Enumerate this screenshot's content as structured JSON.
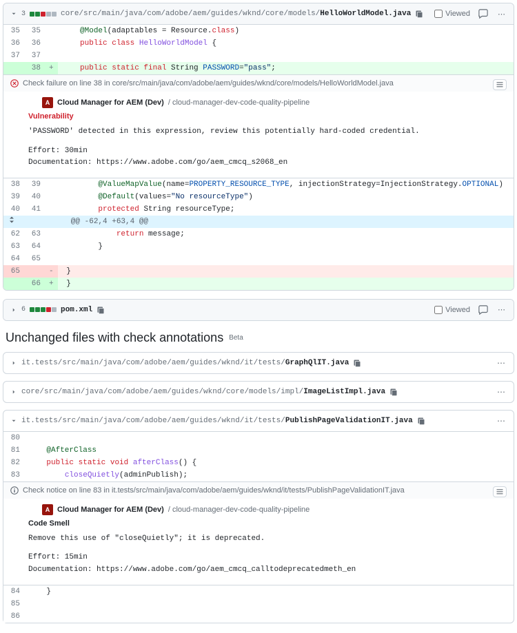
{
  "viewed_label": "Viewed",
  "file1": {
    "changes": "3",
    "path_prefix": "core/src/main/java/com/adobe/aem/guides/wknd/core/models/",
    "path_file": "HelloWorldModel.java",
    "lines": {
      "l35a": "35",
      "l35b": "35",
      "c35": "    @Model(adaptables = Resource.class)",
      "l36a": "36",
      "l36b": "36",
      "c36": "    public class HelloWorldModel {",
      "l37a": "37",
      "l37b": "37",
      "c37": "",
      "l38b": "38",
      "c38": "    public static final String PASSWORD=\"pass\";",
      "l39a": "38",
      "l39b": "39",
      "c39": "        @ValueMapValue(name=PROPERTY_RESOURCE_TYPE, injectionStrategy=InjectionStrategy.OPTIONAL)",
      "l40a": "39",
      "l40b": "40",
      "c40": "        @Default(values=\"No resourceType\")",
      "l41a": "40",
      "l41b": "41",
      "c41": "        protected String resourceType;",
      "hunk": "  @@ -62,4 +63,4 @@",
      "l62a": "62",
      "l62b": "63",
      "c62": "            return message;",
      "l63a": "63",
      "l63b": "64",
      "c63": "        }",
      "l64a": "64",
      "l64b": "65",
      "c64": "",
      "l65a": "65",
      "c65d": "  - }",
      "l66b": "66",
      "c66a": "  + }"
    },
    "annotation": {
      "header": "Check failure on line 38 in core/src/main/java/com/adobe/aem/guides/wknd/core/models/HelloWorldModel.java",
      "app": "Cloud Manager for AEM (Dev)",
      "pipe": "/ cloud-manager-dev-code-quality-pipeline",
      "kind": "Vulnerability",
      "msg": "'PASSWORD' detected in this expression, review this potentially hard-coded credential.",
      "effort": "Effort: 30min",
      "doc": "Documentation: https://www.adobe.com/go/aem_cmcq_s2068_en"
    }
  },
  "file2": {
    "changes": "6",
    "path_file": "pom.xml"
  },
  "section_title": "Unchanged files with check annotations",
  "section_badge": "Beta",
  "file3": {
    "path_prefix": "it.tests/src/main/java/com/adobe/aem/guides/wknd/it/tests/",
    "path_file": "GraphQlIT.java"
  },
  "file4": {
    "path_prefix": "core/src/main/java/com/adobe/aem/guides/wknd/core/models/impl/",
    "path_file": "ImageListImpl.java"
  },
  "file5": {
    "path_prefix": "it.tests/src/main/java/com/adobe/aem/guides/wknd/it/tests/",
    "path_file": "PublishPageValidationIT.java",
    "lines": {
      "l80": "80",
      "c80": "",
      "l81": "81",
      "c81": "    @AfterClass",
      "l82": "82",
      "c82": "    public static void afterClass() {",
      "l83": "83",
      "c83": "        closeQuietly(adminPublish);",
      "l84": "84",
      "c84": "    }",
      "l85": "85",
      "c85": "",
      "l86": "86",
      "c86": ""
    },
    "annotation": {
      "header": "Check notice on line 83 in it.tests/src/main/java/com/adobe/aem/guides/wknd/it/tests/PublishPageValidationIT.java",
      "app": "Cloud Manager for AEM (Dev)",
      "pipe": "/ cloud-manager-dev-code-quality-pipeline",
      "kind": "Code Smell",
      "msg": "Remove this use of \"closeQuietly\"; it is deprecated.",
      "effort": "Effort: 15min",
      "doc": "Documentation: https://www.adobe.com/go/aem_cmcq_calltodeprecatedmeth_en"
    }
  }
}
